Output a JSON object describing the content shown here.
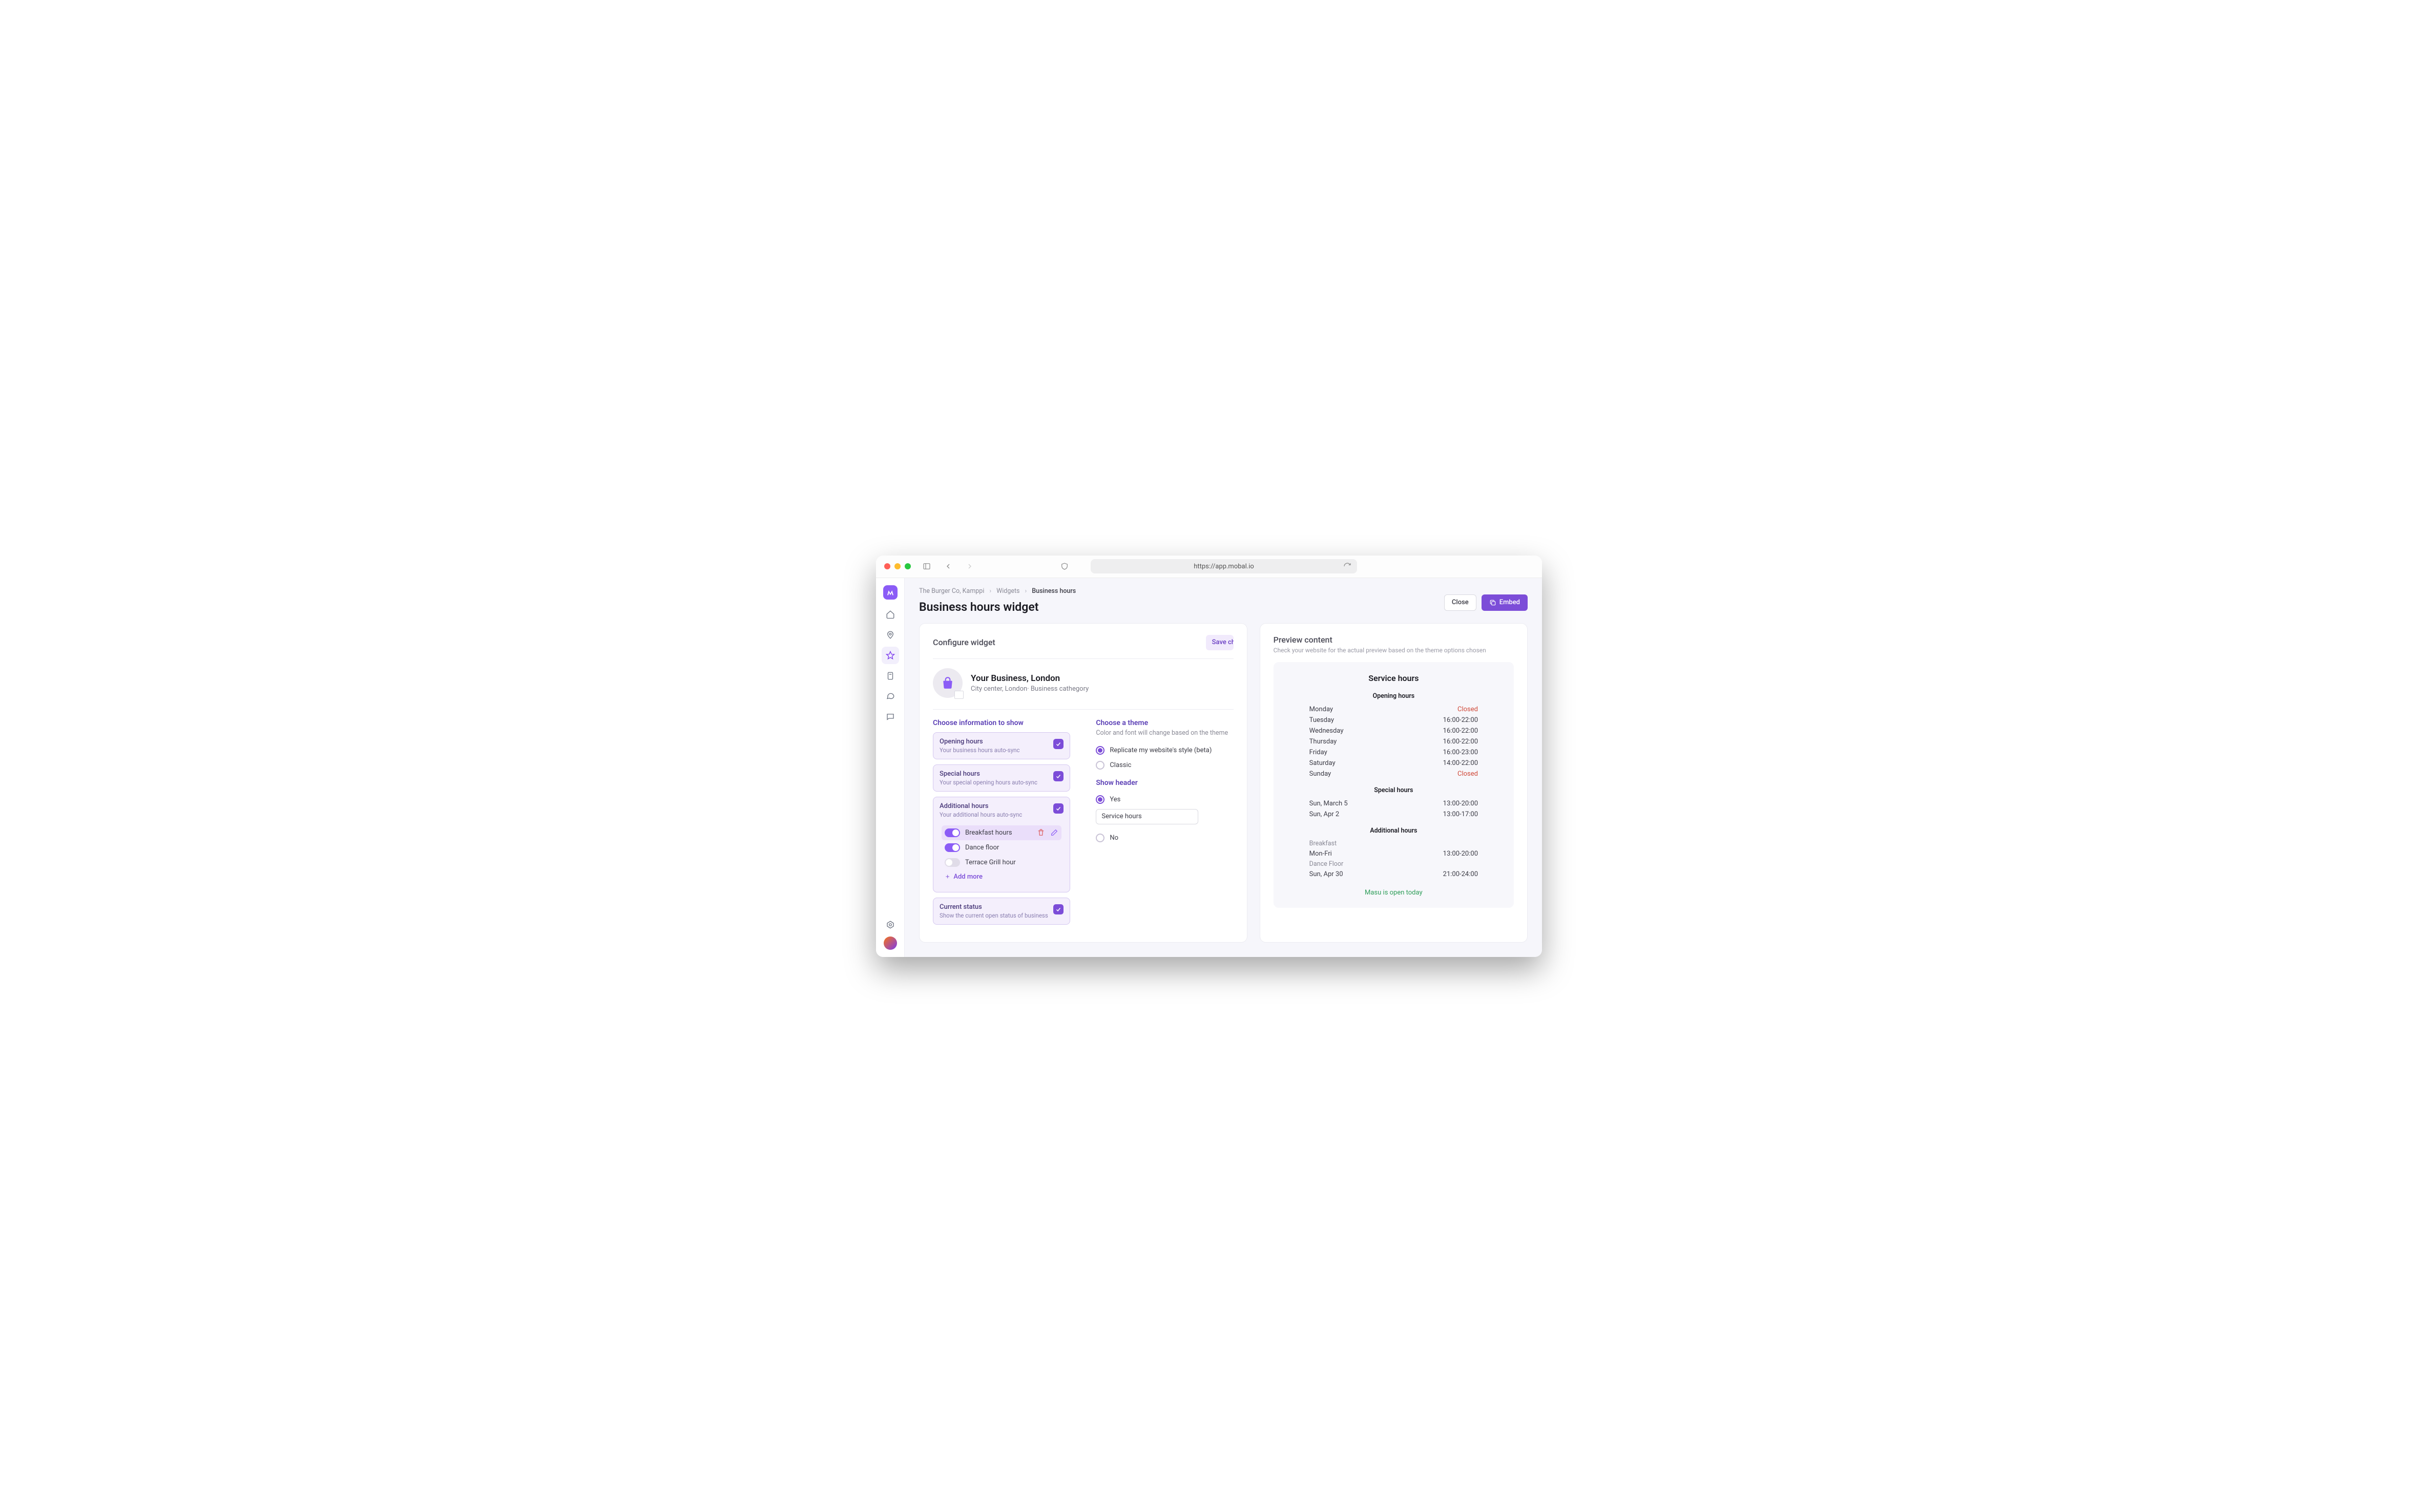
{
  "browser": {
    "url": "https://app.mobal.io"
  },
  "breadcrumbs": {
    "a": "The Burger Co, Kamppi",
    "b": "Widgets",
    "c": "Business hours"
  },
  "page": {
    "title": "Business hours widget"
  },
  "actions": {
    "close": "Close",
    "embed": "Embed"
  },
  "configure": {
    "heading": "Configure widget",
    "save": "Save changes",
    "business": {
      "name": "Your Business, London",
      "meta": "City center,  London· Business cathegory"
    },
    "info_heading": "Choose information to show",
    "opts": {
      "opening": {
        "t": "Opening hours",
        "s": "Your business hours auto-sync"
      },
      "special": {
        "t": "Special hours",
        "s": "Your special opening hours auto-sync"
      },
      "additional": {
        "t": "Additional hours",
        "s": "Your additional hours auto-sync"
      },
      "current": {
        "t": "Current status",
        "s": "Show the current open status of business"
      }
    },
    "additional_items": {
      "a": "Breakfast hours",
      "b": "Dance floor",
      "c": "Terrace Grill hour"
    },
    "add_more": "Add more",
    "theme_heading": "Choose a theme",
    "theme_sub": "Color and font will change based on the theme",
    "theme_a": "Replicate my website's style (beta)",
    "theme_b": "Classic",
    "header_heading": "Show header",
    "header_yes": "Yes",
    "header_no": "No",
    "header_input": "Service hours"
  },
  "preview": {
    "heading": "Preview content",
    "sub": "Check your website for the actual preview based on the theme options chosen",
    "title": "Service hours",
    "sect_opening": "Opening hours",
    "opening": [
      {
        "d": "Monday",
        "h": "Closed",
        "closed": true
      },
      {
        "d": "Tuesday",
        "h": "16:00-22:00"
      },
      {
        "d": "Wednesday",
        "h": "16:00-22:00"
      },
      {
        "d": "Thursday",
        "h": "16:00-22:00"
      },
      {
        "d": "Friday",
        "h": "16:00-23:00"
      },
      {
        "d": "Saturday",
        "h": "14:00-22:00"
      },
      {
        "d": "Sunday",
        "h": "Closed",
        "closed": true
      }
    ],
    "sect_special": "Special hours",
    "special": [
      {
        "d": "Sun, March 5",
        "h": "13:00-20:00"
      },
      {
        "d": "Sun, Apr 2",
        "h": "13:00-17:00"
      }
    ],
    "sect_additional": "Additional hours",
    "additional": [
      {
        "cat": "Breakfast"
      },
      {
        "d": "Mon-Fri",
        "h": "13:00-20:00"
      },
      {
        "cat": "Dance Floor"
      },
      {
        "d": "Sun, Apr 30",
        "h": "21:00-24:00"
      }
    ],
    "open_text": "Masu is open today"
  }
}
